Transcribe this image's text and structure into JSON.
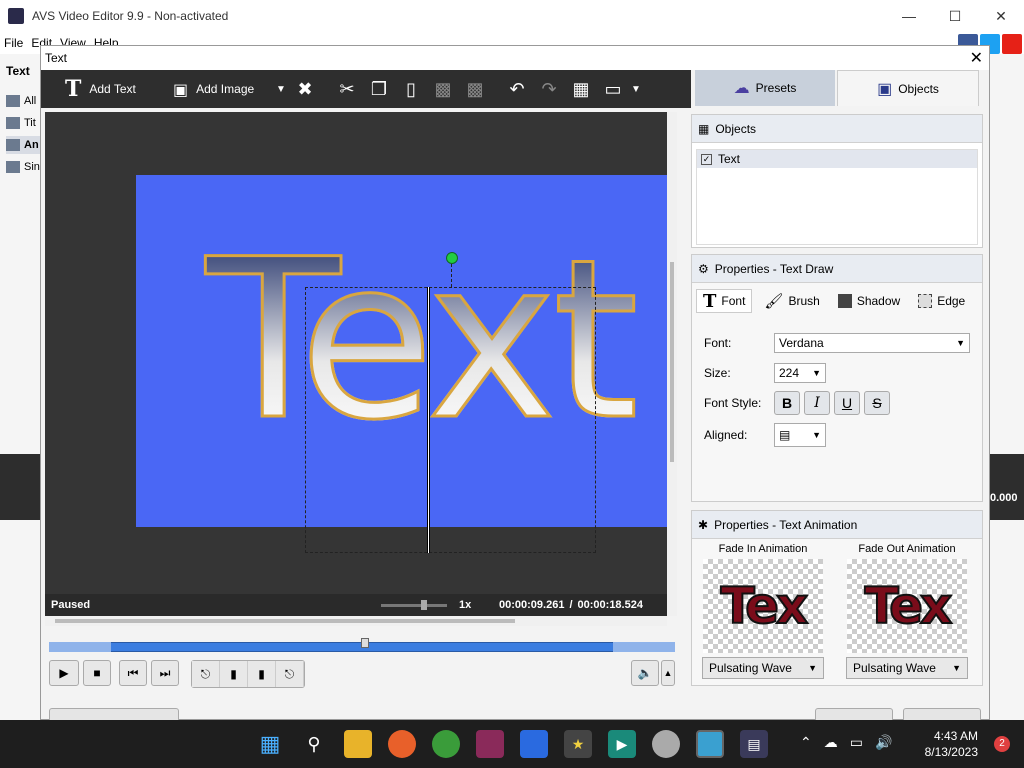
{
  "main": {
    "title": "AVS Video Editor 9.9 - Non-activated",
    "menu": [
      "File",
      "Edit",
      "View",
      "Help"
    ],
    "left_tab": "Text",
    "left_items": [
      "All",
      "Tit",
      "An",
      "Sin"
    ],
    "right_value": "0.000"
  },
  "dialog": {
    "title": "Text",
    "toolbar": {
      "add_text": "Add Text",
      "add_image": "Add Image"
    },
    "tabs": {
      "presets": "Presets",
      "objects": "Objects"
    },
    "preview": {
      "canvas_text": "Text",
      "status": "Paused",
      "speed": "1x",
      "current_time": "00:00:09.261",
      "separator": "/",
      "total_time": "00:00:18.524"
    },
    "objects_panel": {
      "title": "Objects",
      "items": [
        "Text"
      ]
    },
    "properties": {
      "title": "Properties - Text Draw",
      "tabs": [
        "Font",
        "Brush",
        "Shadow",
        "Edge"
      ],
      "font_label": "Font:",
      "font_value": "Verdana",
      "size_label": "Size:",
      "size_value": "224",
      "style_label": "Font Style:",
      "style_buttons": [
        "B",
        "I",
        "U",
        "S"
      ],
      "aligned_label": "Aligned:"
    },
    "animation": {
      "title": "Properties - Text Animation",
      "fade_in_label": "Fade In Animation",
      "fade_out_label": "Fade Out Animation",
      "fade_in_value": "Pulsating Wave",
      "fade_out_value": "Pulsating Wave",
      "thumb_text": "Tex"
    }
  },
  "taskbar": {
    "time": "4:43 AM",
    "date": "8/13/2023",
    "notifications": "2"
  },
  "colors": {
    "canvas_blue": "#4a67f5",
    "toolbar_dark": "#2e2e2e",
    "timeline_blue": "#3b7de0"
  }
}
